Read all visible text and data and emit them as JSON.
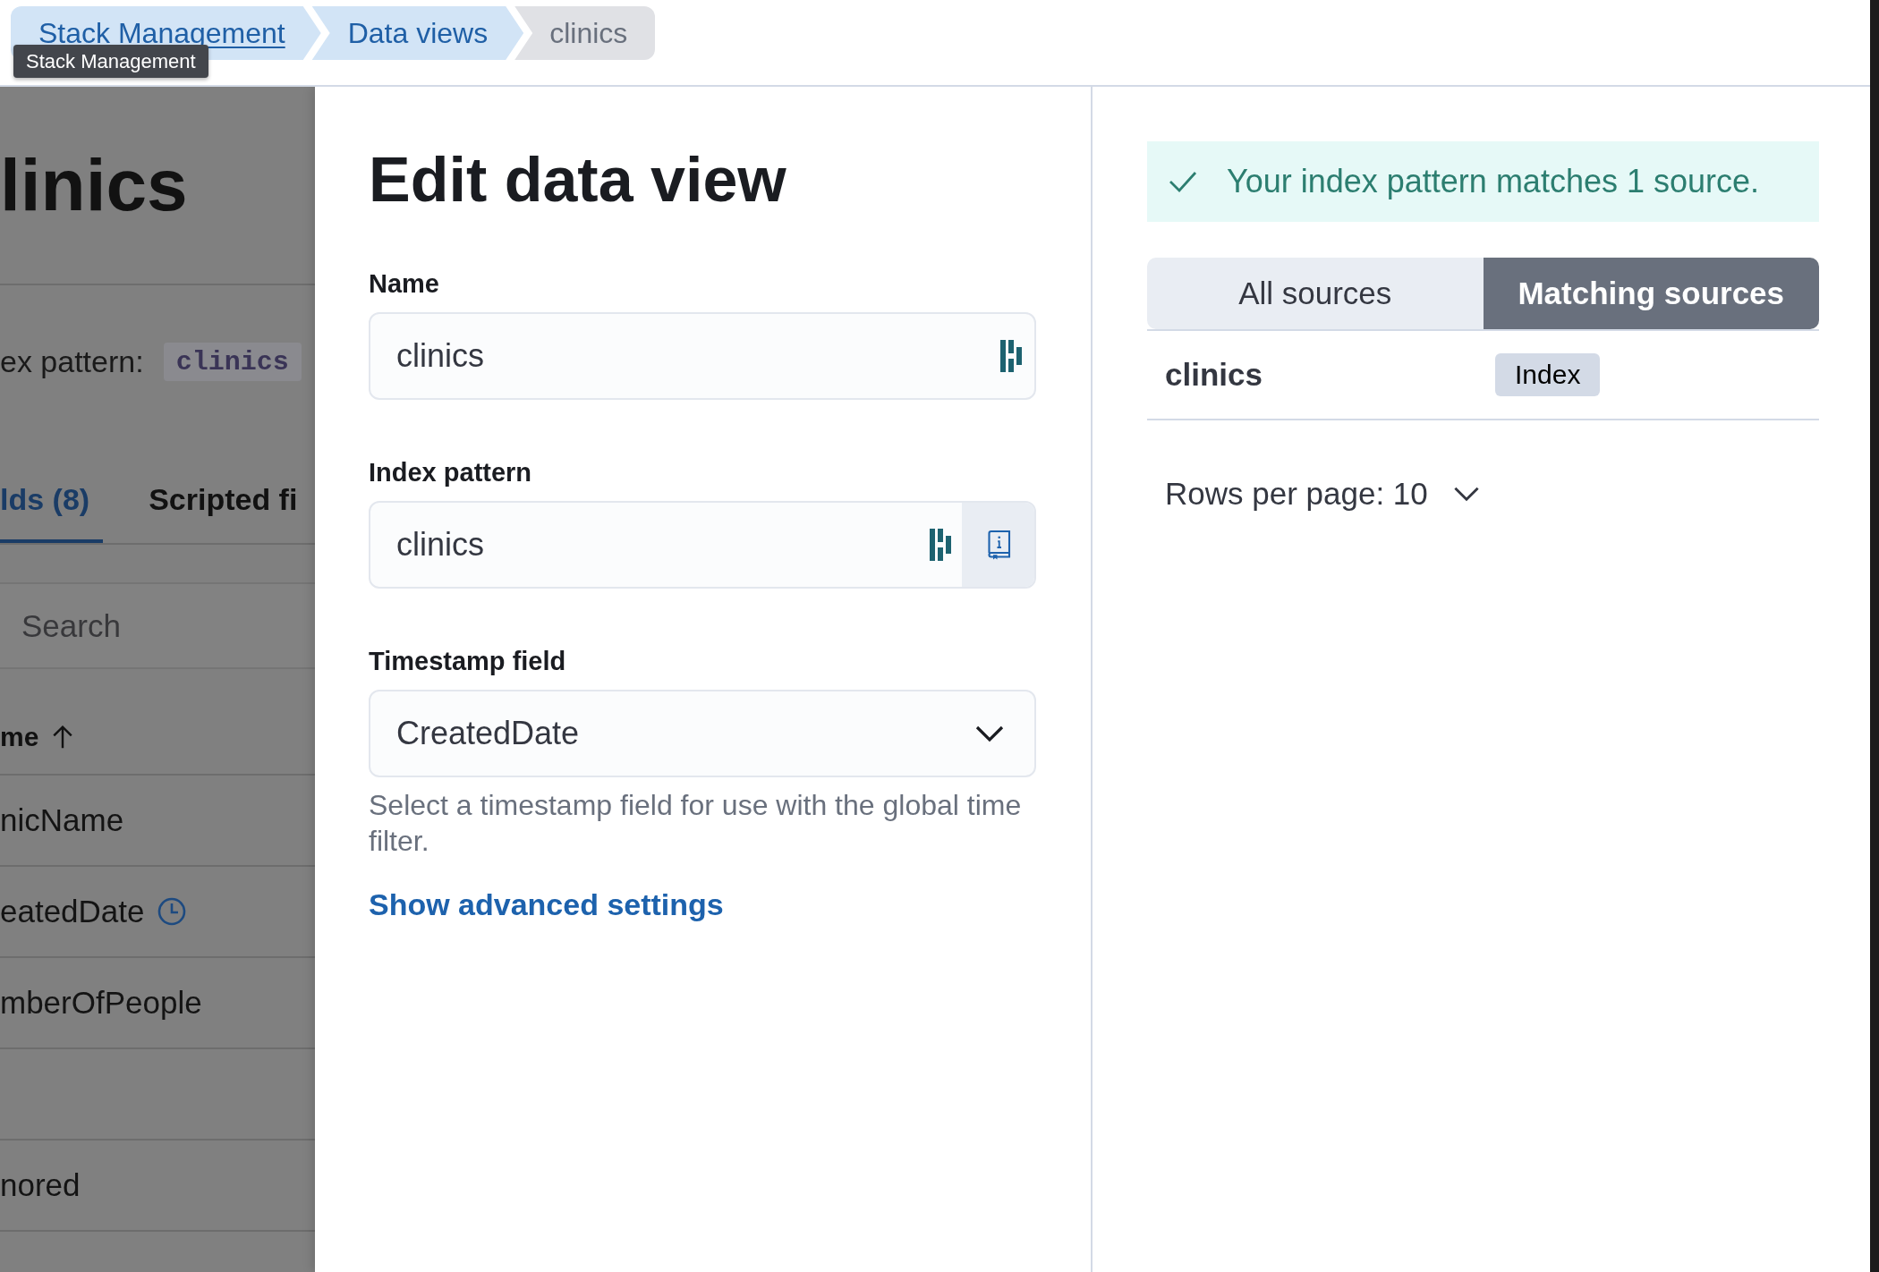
{
  "breadcrumbs": [
    {
      "label": "Stack Management",
      "kind": "link",
      "hovered": true
    },
    {
      "label": "Data views",
      "kind": "link",
      "hovered": false
    },
    {
      "label": "clinics",
      "kind": "current",
      "hovered": false
    }
  ],
  "tooltip": {
    "text": "Stack Management"
  },
  "background_page": {
    "title": "linics",
    "index_pattern": {
      "label": "ex pattern:",
      "value": "clinics"
    },
    "tabs": [
      {
        "label": "lds (8)",
        "selected": true
      },
      {
        "label": "Scripted fi",
        "selected": false
      }
    ],
    "search": {
      "placeholder": "Search"
    },
    "table": {
      "header": {
        "label": "me",
        "sorted": true
      },
      "rows": [
        {
          "name": "nicName",
          "is_timestamp": false
        },
        {
          "name": "eatedDate",
          "is_timestamp": true
        },
        {
          "name": "mberOfPeople",
          "is_timestamp": false
        },
        {
          "is_timestamp": false
        },
        {
          "name": "nored",
          "is_timestamp": false
        }
      ]
    }
  },
  "flyout": {
    "title": "Edit data view",
    "fields": [
      {
        "kind": "text",
        "label": "Name",
        "value": "clinics"
      },
      {
        "kind": "text_with_button",
        "label": "Index pattern",
        "value": "clinics"
      },
      {
        "kind": "select",
        "label": "Timestamp field",
        "value": "CreatedDate",
        "help": "Select a timestamp field for use with the global time filter."
      }
    ],
    "advanced_link": "Show advanced settings"
  },
  "preview": {
    "callout": {
      "kind": "success",
      "text": "Your index pattern matches 1 source."
    },
    "tabs": [
      {
        "label": "All sources",
        "selected": false
      },
      {
        "label": "Matching sources",
        "selected": true
      }
    ],
    "rows": [
      {
        "name": "clinics",
        "type": "Index"
      }
    ],
    "pagination": "Rows per page: 10"
  }
}
